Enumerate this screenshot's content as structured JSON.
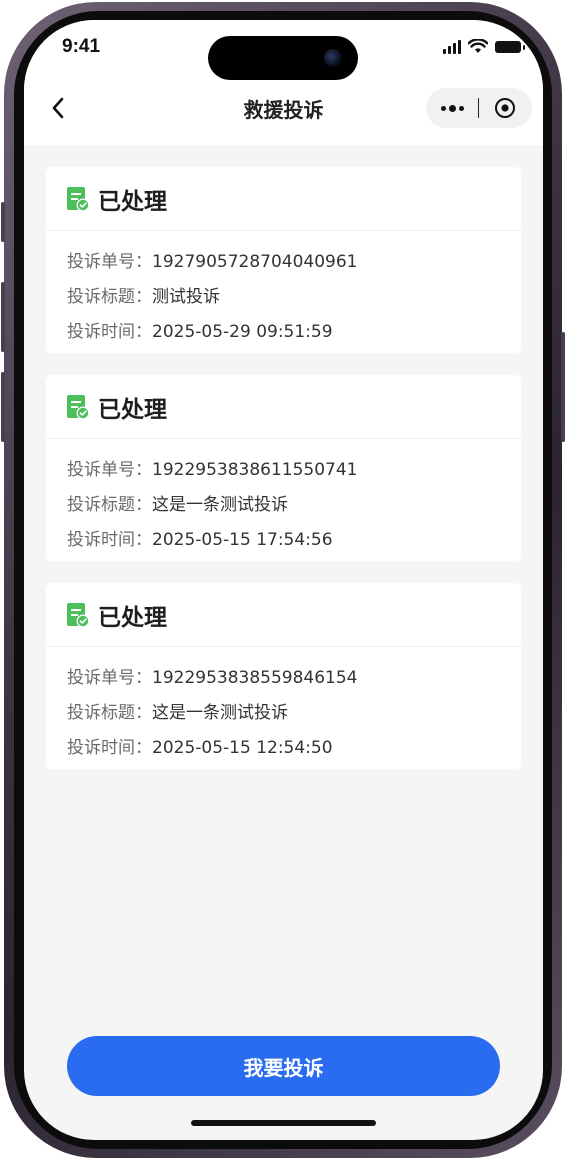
{
  "status_bar": {
    "time": "9:41"
  },
  "nav": {
    "title": "救援投诉"
  },
  "complaints": [
    {
      "status": "已处理",
      "number_label": "投诉单号：",
      "number": "1927905728704040961",
      "title_label": "投诉标题：",
      "title": "测试投诉",
      "time_label": "投诉时间：",
      "time": "2025-05-29  09:51:59"
    },
    {
      "status": "已处理",
      "number_label": "投诉单号：",
      "number": "1922953838611550741",
      "title_label": "投诉标题：",
      "title": "这是一条测试投诉",
      "time_label": "投诉时间：",
      "time": "2025-05-15  17:54:56"
    },
    {
      "status": "已处理",
      "number_label": "投诉单号：",
      "number": "1922953838559846154",
      "title_label": "投诉标题：",
      "title": "这是一条测试投诉",
      "time_label": "投诉时间：",
      "time": "2025-05-15  12:54:50"
    }
  ],
  "submit_button": {
    "label": "我要投诉"
  },
  "colors": {
    "accent": "#2a6cf0",
    "status_icon": "#4cbf5a",
    "background": "#f5f5f5"
  },
  "icons": {
    "back": "chevron-left-icon",
    "more": "more-dots-icon",
    "close": "target-circle-icon",
    "status": "document-check-icon"
  }
}
